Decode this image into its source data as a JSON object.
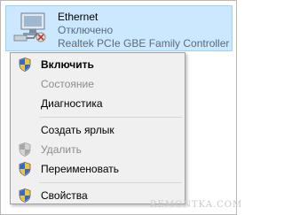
{
  "adapter": {
    "name": "Ethernet",
    "status": "Отключено",
    "device": "Realtek PCIe GBE Family Controller"
  },
  "menu": {
    "items": [
      {
        "label": "Включить",
        "bold": true,
        "disabled": false,
        "shield": true
      },
      {
        "label": "Состояние",
        "bold": false,
        "disabled": true,
        "shield": false
      },
      {
        "label": "Диагностика",
        "bold": false,
        "disabled": false,
        "shield": false
      },
      {
        "label": "Создать ярлык",
        "bold": false,
        "disabled": false,
        "shield": false
      },
      {
        "label": "Удалить",
        "bold": false,
        "disabled": true,
        "shield": true
      },
      {
        "label": "Переименовать",
        "bold": false,
        "disabled": false,
        "shield": true
      },
      {
        "label": "Свойства",
        "bold": false,
        "disabled": false,
        "shield": true
      }
    ]
  },
  "watermark": "REMONTKA.COM",
  "colors": {
    "selection_bg": "#cce8ff",
    "selection_border": "#99d1ff",
    "disabled_text": "#8c8c8c",
    "menu_bg": "#f0f0f0"
  }
}
